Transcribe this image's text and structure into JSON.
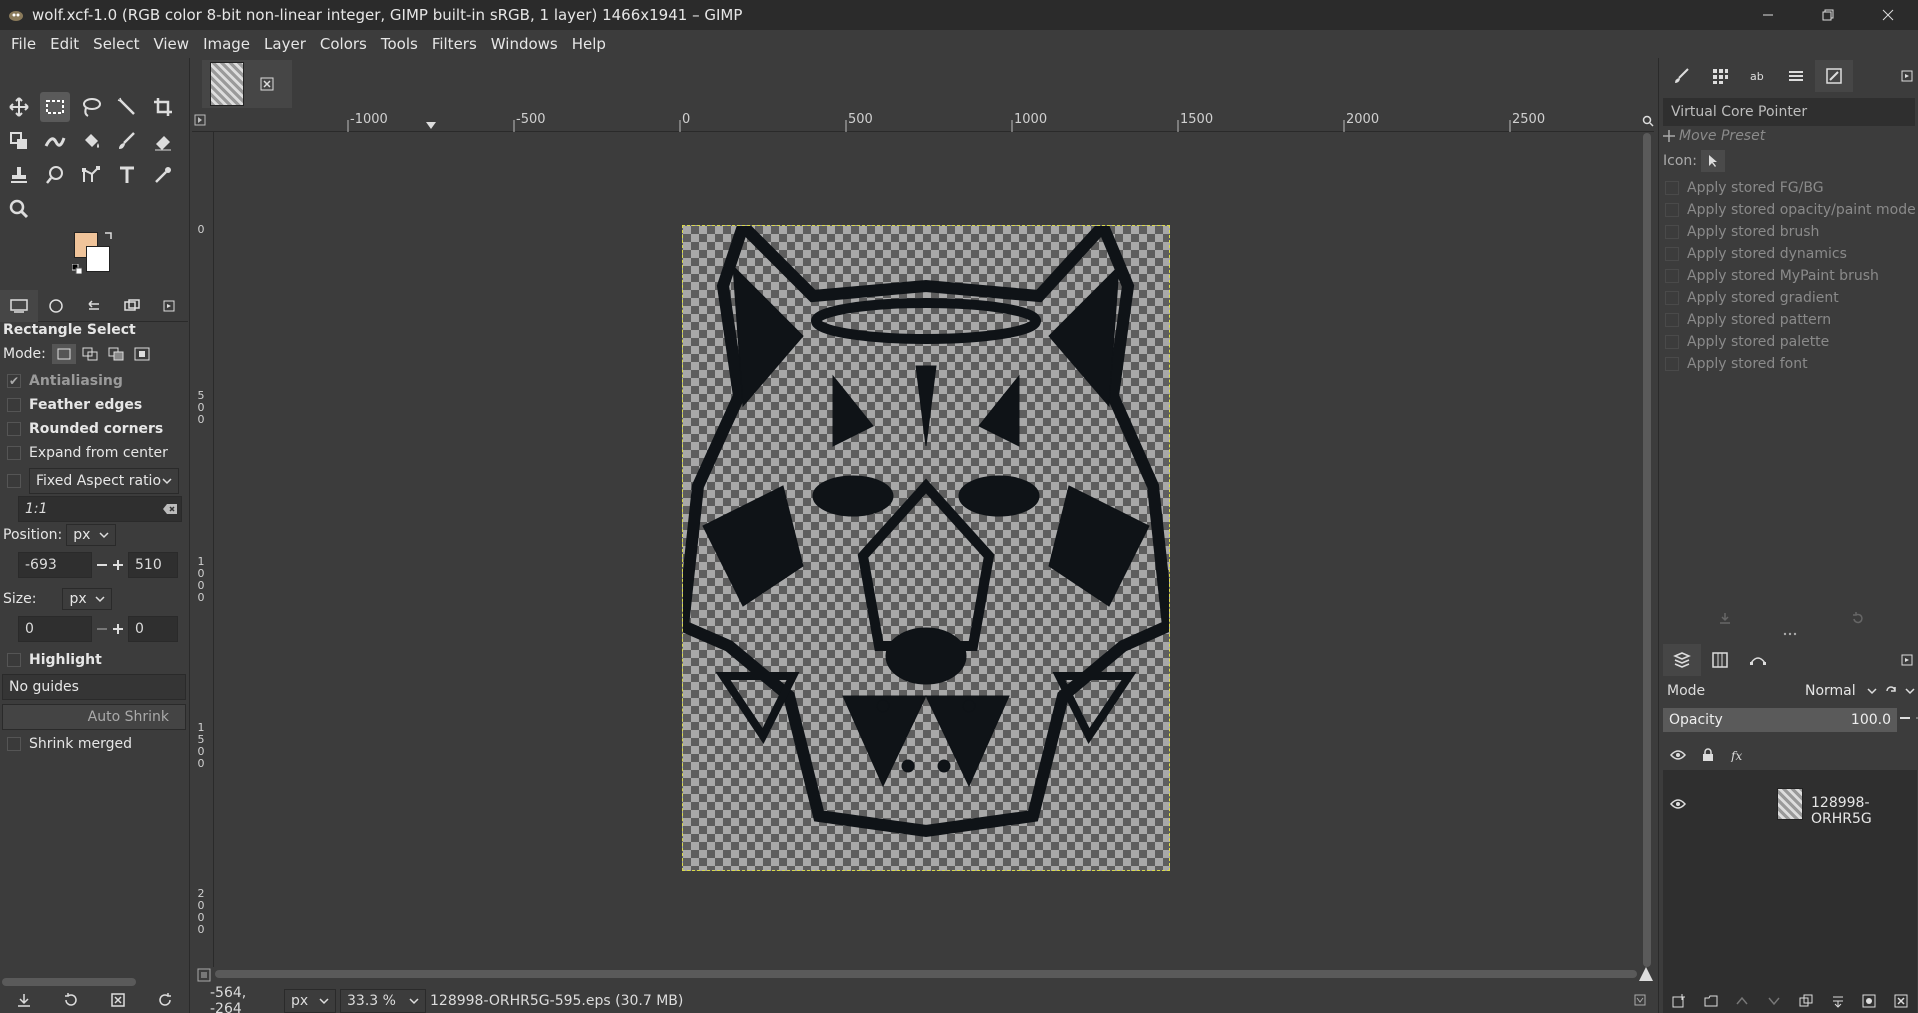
{
  "window": {
    "title": "wolf.xcf-1.0 (RGB color 8-bit non-linear integer, GIMP built-in sRGB, 1 layer) 1466x1941 – GIMP"
  },
  "menu": [
    "File",
    "Edit",
    "Select",
    "View",
    "Image",
    "Layer",
    "Colors",
    "Tools",
    "Filters",
    "Windows",
    "Help"
  ],
  "colors": {
    "foreground": "#f0c49a",
    "background": "#ffffff",
    "accent_dark": "#2b2b2b",
    "selection_outline": "#d9d94a"
  },
  "tool_options": {
    "title": "Rectangle Select",
    "mode_label": "Mode:",
    "antialiasing": "Antialiasing",
    "feather_edges": "Feather edges",
    "rounded_corners": "Rounded corners",
    "expand_from_center": "Expand from center",
    "fixed_aspect": "Fixed Aspect ratio",
    "aspect_value": "1:1",
    "position_label": "Position:",
    "position_unit": "px",
    "position_x": "-693",
    "position_y": "510",
    "size_label": "Size:",
    "size_unit": "px",
    "size_w": "0",
    "size_h": "0",
    "highlight": "Highlight",
    "guides": "No guides",
    "auto_shrink": "Auto Shrink",
    "shrink_merged": "Shrink merged"
  },
  "ruler": {
    "top_labels": [
      "-1000",
      "-500",
      "0",
      "500",
      "1000",
      "1500",
      "2000",
      "2500"
    ],
    "left_labels": [
      "0",
      "500",
      "1000",
      "1500",
      "2000"
    ]
  },
  "statusbar": {
    "coords": "-564, -264",
    "unit": "px",
    "zoom": "33.3 %",
    "info": "128998-ORHR5G-595.eps (30.7 MB)"
  },
  "device_status": {
    "device": "Virtual Core Pointer",
    "move_preset": "Move Preset",
    "icon_label": "Icon:",
    "options": [
      "Apply stored FG/BG",
      "Apply stored opacity/paint mode",
      "Apply stored brush",
      "Apply stored dynamics",
      "Apply stored MyPaint brush",
      "Apply stored gradient",
      "Apply stored pattern",
      "Apply stored palette",
      "Apply stored font"
    ]
  },
  "layers": {
    "mode_label": "Mode",
    "mode_value": "Normal",
    "opacity_label": "Opacity",
    "opacity_value": "100.0",
    "items": [
      {
        "name": "128998-ORHR5G"
      }
    ]
  }
}
